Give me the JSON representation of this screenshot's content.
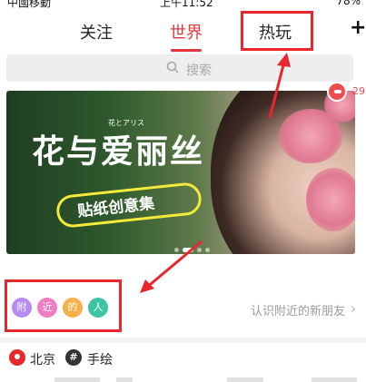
{
  "status": {
    "carrier": "中國移動",
    "time": "上午11:52",
    "battery": "78%"
  },
  "tabs": {
    "follow": "关注",
    "world": "世界",
    "hot": "热玩",
    "plus": "+"
  },
  "search": {
    "placeholder": "搜索",
    "icon": "search-icon"
  },
  "banner": {
    "title": "花与爱丽丝",
    "small_text": "花とアリス",
    "subtitle": "贴纸创意集",
    "page_count": 4,
    "active_page": 2
  },
  "comment": {
    "count": "29",
    "icon": "comment-icon"
  },
  "nearby": {
    "chips": [
      {
        "label": "附",
        "color": "#b38bf2"
      },
      {
        "label": "近",
        "color": "#f07cc2"
      },
      {
        "label": "的",
        "color": "#f5b04a"
      },
      {
        "label": "人",
        "color": "#3dc4a3"
      }
    ],
    "link": "认识附近的新朋友",
    "chevron": "›"
  },
  "tags": {
    "location": "北京",
    "topic": "手绘"
  },
  "colors": {
    "accent": "#e5363a",
    "highlight_box": "#e8262b"
  }
}
